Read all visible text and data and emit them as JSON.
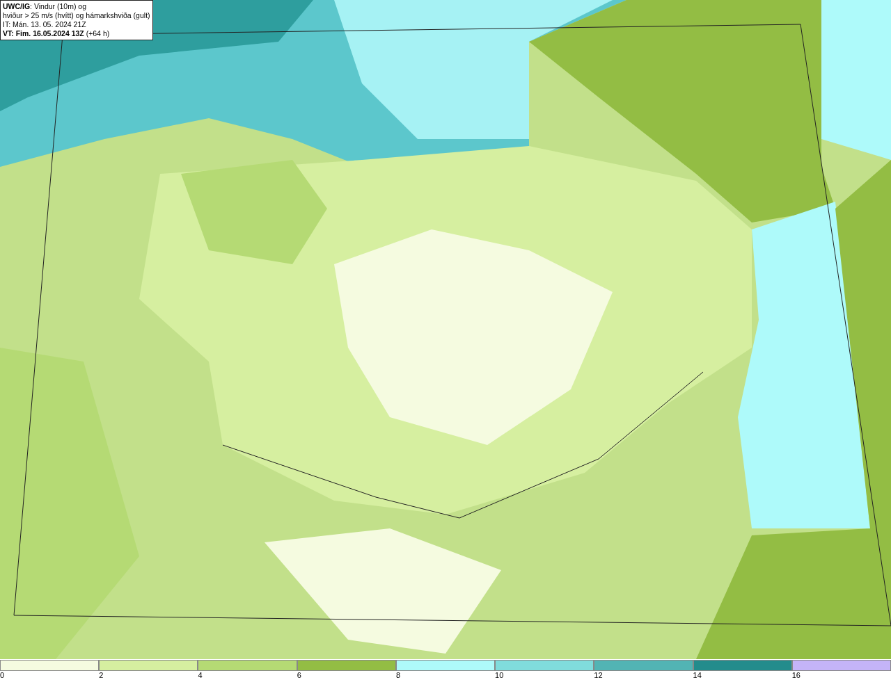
{
  "title_box": {
    "lines": [
      "**UWC/IG**: Vindur (10m) og",
      "hviður > 25 m/s (hvítt) og hámarkshviða (gult)",
      "IT: Mán. 13. 05. 2024 21Z",
      "**VT: Fim. 16.05.2024 13Z** (+64 h)"
    ]
  },
  "legend": {
    "bins": [
      {
        "label": "0",
        "color": "#f5fbe0"
      },
      {
        "label": "2",
        "color": "#d6efa0"
      },
      {
        "label": "4",
        "color": "#b5da74"
      },
      {
        "label": "6",
        "color": "#93bd44"
      },
      {
        "label": "8",
        "color": "#aefafa"
      },
      {
        "label": "10",
        "color": "#80dcdc"
      },
      {
        "label": "12",
        "color": "#52b4b4"
      },
      {
        "label": "14",
        "color": "#238c8c"
      },
      {
        "label": "16",
        "color": "#c4b4f8"
      }
    ]
  }
}
